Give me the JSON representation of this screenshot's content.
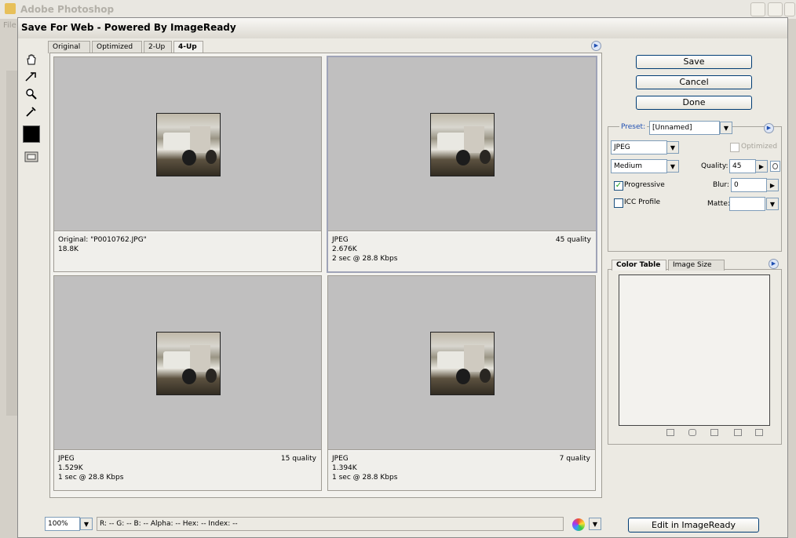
{
  "app": {
    "title": "Adobe Photoshop",
    "menu_first": "File"
  },
  "dialog": {
    "title": "Save For Web - Powered By ImageReady"
  },
  "tabs": [
    {
      "label": "Original",
      "active": false
    },
    {
      "label": "Optimized",
      "active": false
    },
    {
      "label": "2-Up",
      "active": false
    },
    {
      "label": "4-Up",
      "active": true
    }
  ],
  "tools": [
    {
      "icon": "hand-icon"
    },
    {
      "icon": "slice-select-icon"
    },
    {
      "icon": "zoom-icon"
    },
    {
      "icon": "eyedropper-icon"
    },
    {
      "icon": "eyedropper-color-swatch-icon",
      "color": "#000000"
    },
    {
      "icon": "toggle-slices-icon"
    }
  ],
  "panes": [
    {
      "line1": "Original: \"P0010762.JPG\"",
      "line2": "18.8K",
      "line3": "",
      "quality": ""
    },
    {
      "line1": "JPEG",
      "line2": "2.676K",
      "line3": "2 sec @ 28.8 Kbps",
      "quality": "45 quality"
    },
    {
      "line1": "JPEG",
      "line2": "1.529K",
      "line3": "1 sec @ 28.8 Kbps",
      "quality": "15 quality"
    },
    {
      "line1": "JPEG",
      "line2": "1.394K",
      "line3": "1 sec @ 28.8 Kbps",
      "quality": "7 quality"
    }
  ],
  "buttons": {
    "save": "Save",
    "cancel": "Cancel",
    "done": "Done",
    "edit_in_imageready": "Edit in ImageReady"
  },
  "settings": {
    "preset_label": "Preset:",
    "preset_value": "[Unnamed]",
    "format": "JPEG",
    "quality_level": "Medium",
    "optimized_label": "Optimized",
    "optimized_checked": false,
    "quality_label": "Quality:",
    "quality_value": "45",
    "progressive_label": "Progressive",
    "progressive_checked": true,
    "blur_label": "Blur:",
    "blur_value": "0",
    "icc_label": "ICC Profile",
    "icc_checked": false,
    "matte_label": "Matte:",
    "matte_value": ""
  },
  "color_table": {
    "tab_color_table": "Color Table",
    "tab_image_size": "Image Size"
  },
  "status": {
    "zoom": "100%",
    "readout": "R:     --   G:     --   B:     --   Alpha:     --   Hex:          --   Index:      --"
  },
  "colors": {
    "accent_button_border": "#003c74",
    "preview_bg": "#c0bfbf",
    "preset_label": "#1f4fb2"
  }
}
